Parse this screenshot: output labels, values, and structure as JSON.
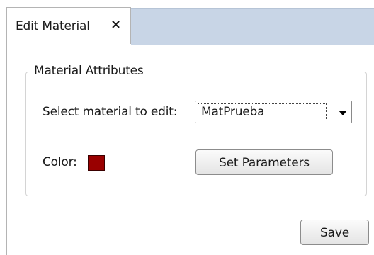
{
  "tab": {
    "label": "Edit Material",
    "close_glyph": "×"
  },
  "group": {
    "title": "Material Attributes"
  },
  "material_select": {
    "label": "Select material to edit:",
    "value": "MatPrueba"
  },
  "color": {
    "label": "Color:",
    "swatch_hex": "#990000"
  },
  "buttons": {
    "set_parameters": "Set Parameters",
    "save": "Save"
  },
  "theme": {
    "tabbar_fill": "#c8d5e6",
    "border": "#b4b4b4"
  }
}
